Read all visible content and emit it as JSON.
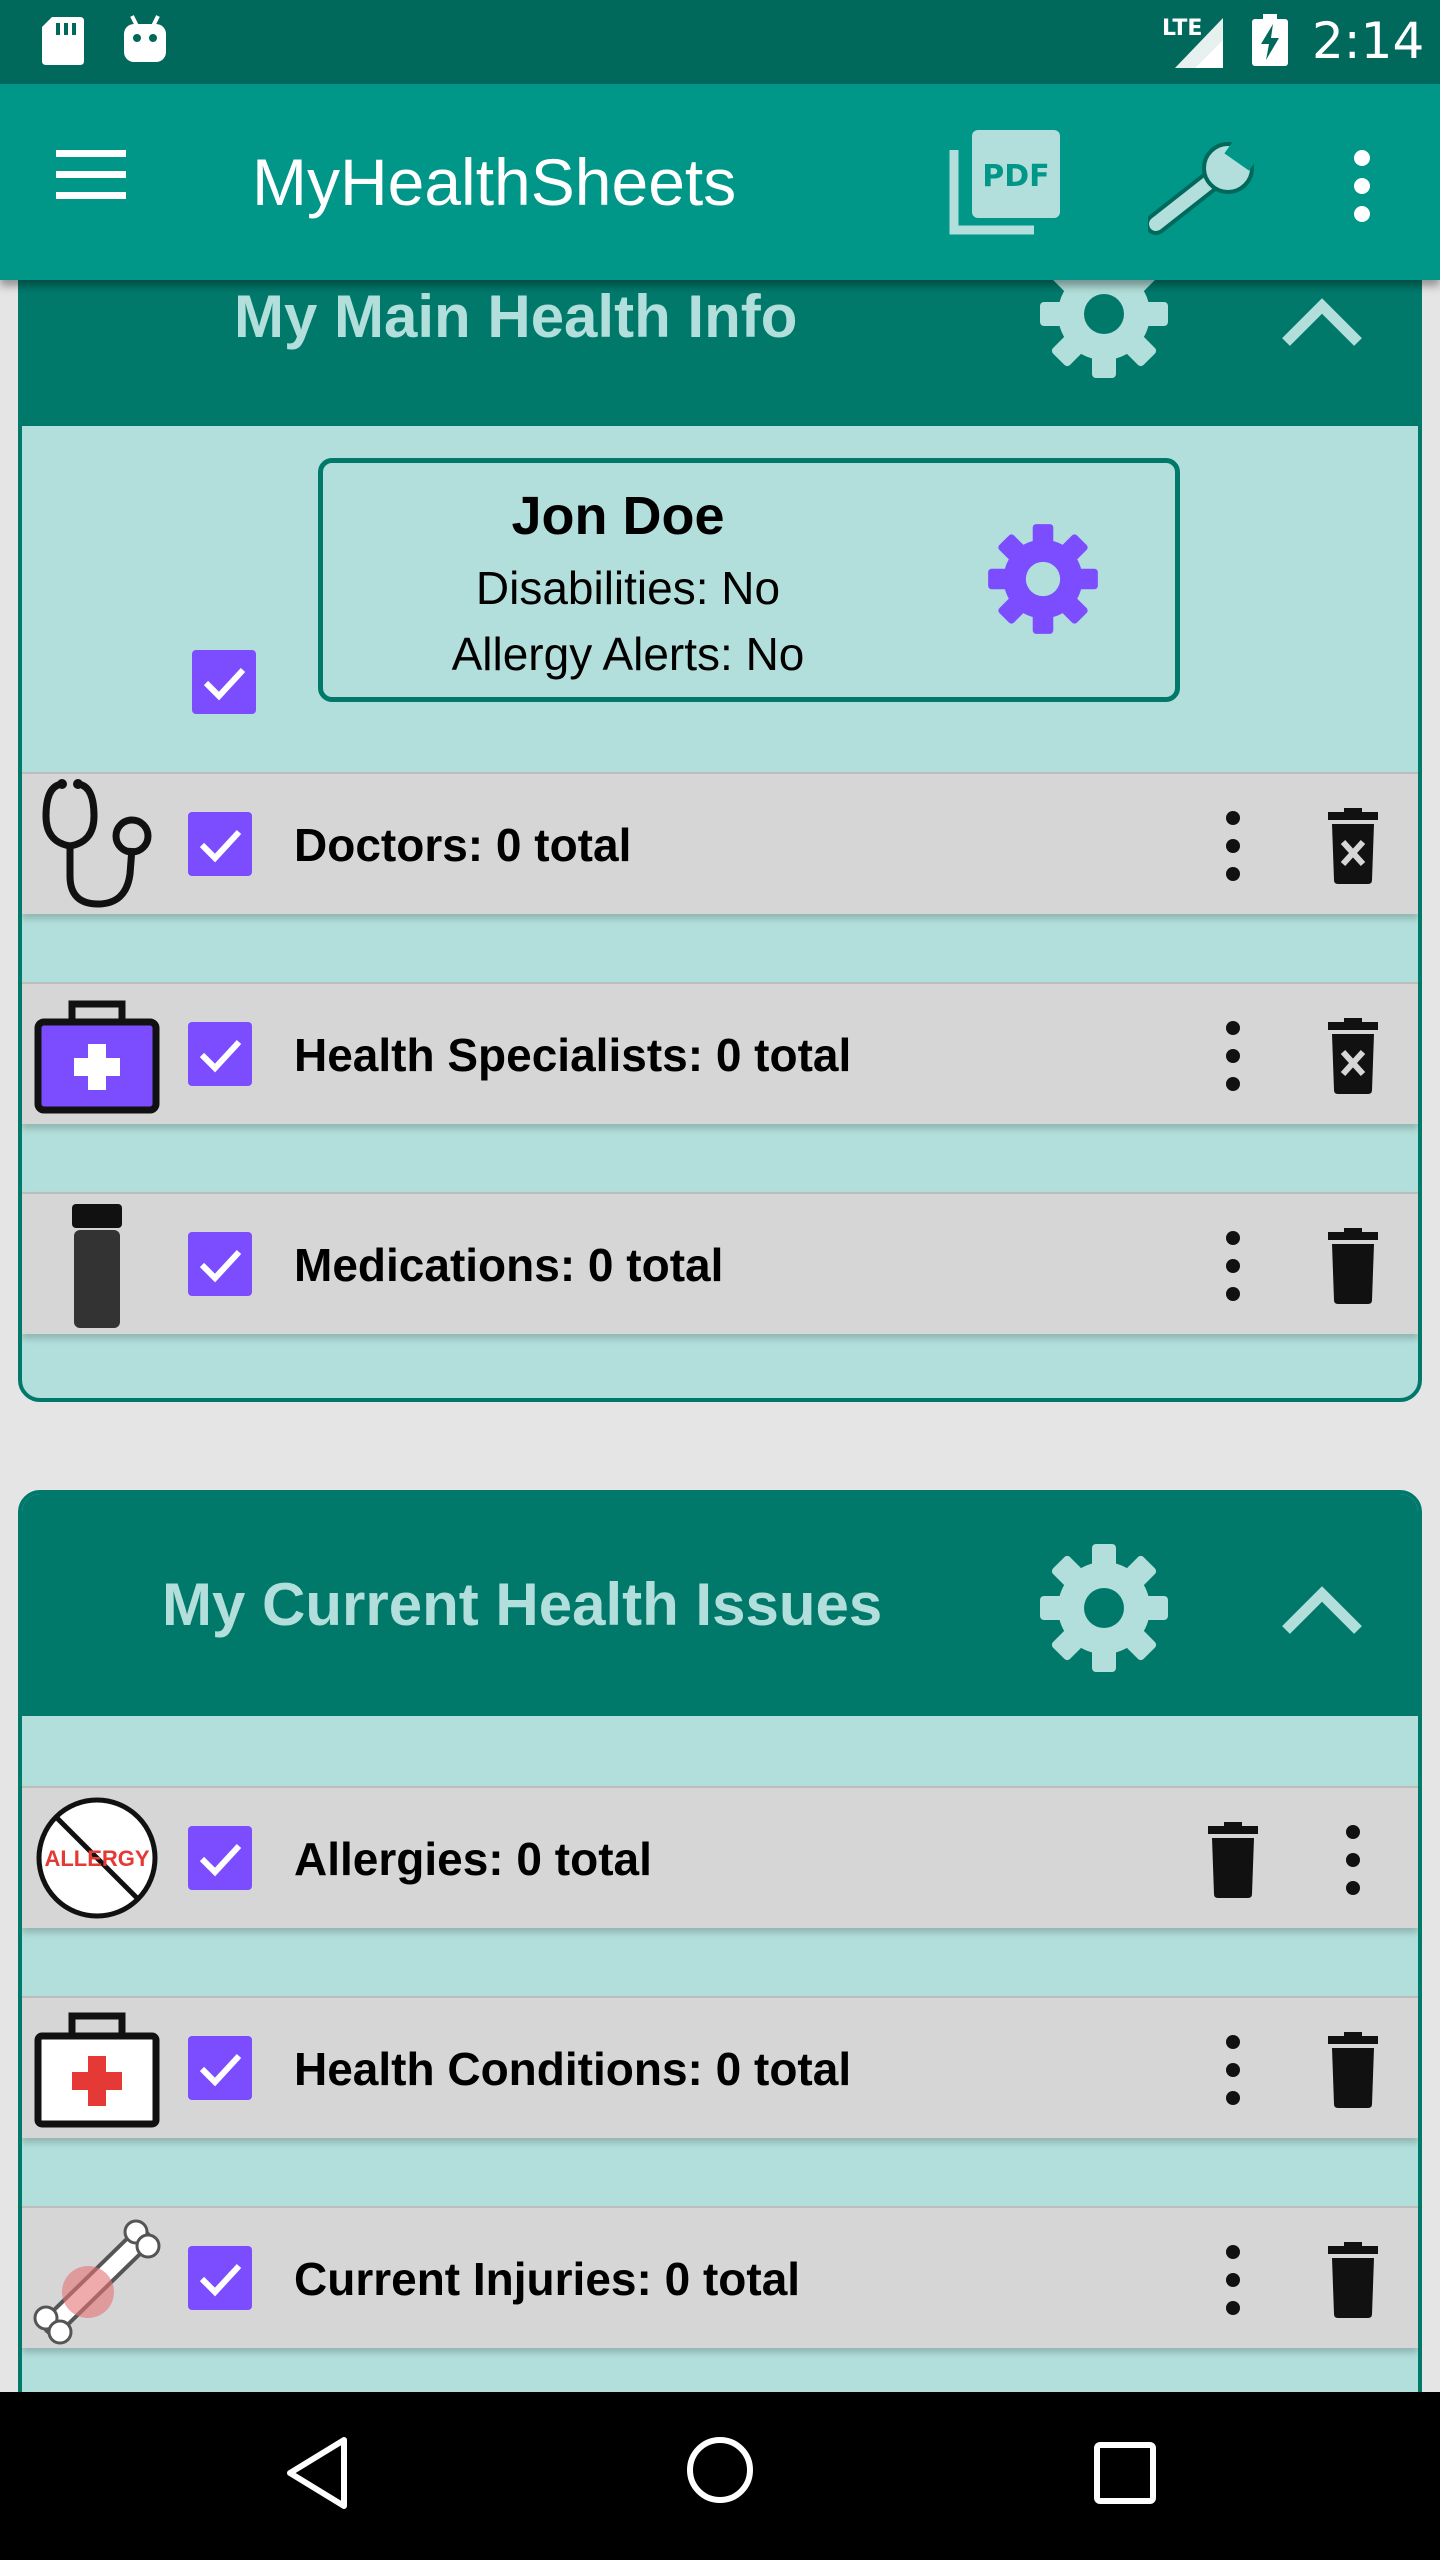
{
  "status_bar": {
    "time": "2:14",
    "network": "LTE",
    "icons": [
      "sd-card-icon",
      "android-icon",
      "signal-icon",
      "battery-charging-icon"
    ]
  },
  "app_bar": {
    "title": "MyHealthSheets",
    "icons": [
      "menu-icon",
      "pdf-icon",
      "wrench-icon",
      "more-vert-icon"
    ]
  },
  "sections": [
    {
      "title": "My Main Health Info",
      "profile": {
        "name": "Jon Doe",
        "disabilities": "Disabilities: No",
        "allergy_alerts": "Allergy Alerts: No",
        "selected": true
      },
      "rows": [
        {
          "label": "Doctors: 0 total",
          "icon": "stethoscope-icon",
          "checked": true,
          "actions": [
            "more-vert-icon",
            "delete-forever-icon"
          ]
        },
        {
          "label": "Health Specialists: 0 total",
          "icon": "medical-kit-icon",
          "checked": true,
          "actions": [
            "more-vert-icon",
            "delete-forever-icon"
          ]
        },
        {
          "label": "Medications: 0 total",
          "icon": "pill-bottle-icon",
          "checked": true,
          "actions": [
            "more-vert-icon",
            "delete-icon"
          ]
        }
      ]
    },
    {
      "title": "My Current Health Issues",
      "rows": [
        {
          "label": "Allergies: 0 total",
          "icon": "no-allergy-icon",
          "icon_text": "ALLERGY",
          "checked": true,
          "actions": [
            "delete-icon",
            "more-vert-icon"
          ]
        },
        {
          "label": "Health Conditions: 0 total",
          "icon": "first-aid-kit-icon",
          "checked": true,
          "actions": [
            "more-vert-icon",
            "delete-icon"
          ]
        },
        {
          "label": "Current Injuries: 0 total",
          "icon": "broken-bone-icon",
          "checked": true,
          "actions": [
            "more-vert-icon",
            "delete-icon"
          ]
        }
      ]
    }
  ],
  "nav_bar": {
    "icons": [
      "back-icon",
      "home-icon",
      "recents-icon"
    ]
  },
  "colors": {
    "status_bar": "#00695c",
    "app_bar": "#009688",
    "card_header": "#00796b",
    "card_body": "#b2dfdb",
    "row_background": "#d6d6d6",
    "checkbox": "#7c4dff",
    "page_background": "#e5e5e5"
  }
}
